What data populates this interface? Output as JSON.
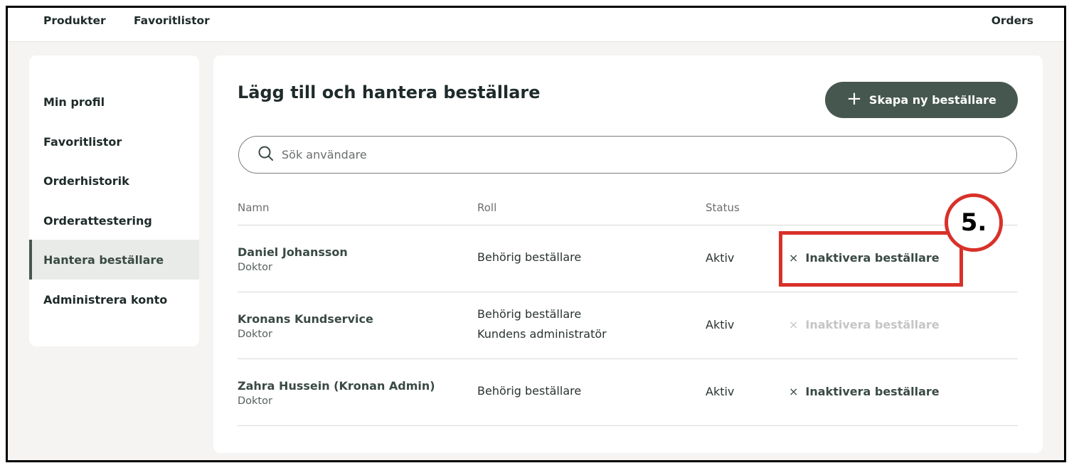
{
  "nav": {
    "produkter": "Produkter",
    "favoritlistor": "Favoritlistor",
    "orders": "Orders"
  },
  "sidebar": {
    "items": [
      {
        "label": "Min profil"
      },
      {
        "label": "Favoritlistor"
      },
      {
        "label": "Orderhistorik"
      },
      {
        "label": "Orderattestering"
      },
      {
        "label": "Hantera beställare",
        "active": true
      },
      {
        "label": "Administrera konto"
      }
    ]
  },
  "main": {
    "title": "Lägg till och hantera beställare",
    "create_button": "Skapa ny beställare",
    "search_placeholder": "Sök användare",
    "columns": {
      "namn": "Namn",
      "roll": "Roll",
      "status": "Status"
    },
    "rows": [
      {
        "name": "Daniel Johansson",
        "subtitle": "Doktor",
        "roles": [
          "Behörig beställare"
        ],
        "status": "Aktiv",
        "action": "Inaktivera beställare",
        "action_enabled": true
      },
      {
        "name": "Kronans Kundservice",
        "subtitle": "Doktor",
        "roles": [
          "Behörig beställare",
          "Kundens administratör"
        ],
        "status": "Aktiv",
        "action": "Inaktivera beställare",
        "action_enabled": false
      },
      {
        "name": "Zahra Hussein (Kronan Admin)",
        "subtitle": "Doktor",
        "roles": [
          "Behörig beställare"
        ],
        "status": "Aktiv",
        "action": "Inaktivera beställare",
        "action_enabled": true
      }
    ]
  },
  "annotation": {
    "step": "5.",
    "color": "#d8312a"
  },
  "colors": {
    "primary": "#46574f",
    "active_bg": "#e8ebe7",
    "disabled_text": "#c4c6c4"
  },
  "icons": {
    "search": "search-icon",
    "plus": "plus-icon",
    "close": "close-icon"
  }
}
